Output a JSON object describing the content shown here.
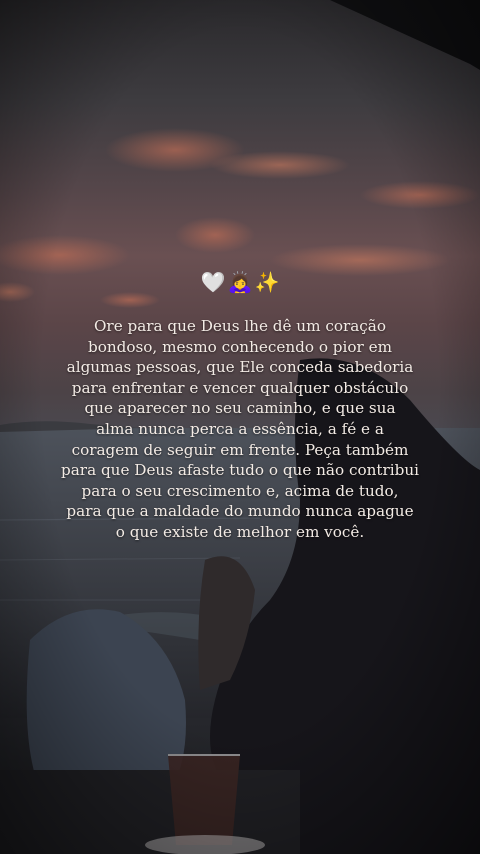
{
  "emojis": [
    {
      "glyph": "🤍",
      "icon": "white-heart-icon"
    },
    {
      "glyph": "🙇‍♀️",
      "icon": "bowing-woman-icon"
    },
    {
      "glyph": "✨",
      "icon": "sparkles-icon"
    }
  ],
  "quote": {
    "lines": [
      "Ore para que Deus lhe dê um coração",
      "bondoso, mesmo conhecendo o pior em",
      "algumas pessoas, que Ele conceda sabedoria",
      "para enfrentar e vencer qualquer obstáculo",
      "que aparecer no seu caminho, e que sua",
      "alma nunca perca a essência, a fé e a",
      "coragem de seguir em frente. Peça também",
      "para que Deus afaste tudo o que não contribui",
      "para o seu crescimento e, acima de tudo,",
      "para que a maldade do mundo nunca apague",
      "o que existe de melhor em você."
    ]
  },
  "colors": {
    "text": "#f3ebe5",
    "sky_top": "#3b3a3e",
    "sunset_glow": "#9a5a48",
    "water": "#4a4f58"
  }
}
